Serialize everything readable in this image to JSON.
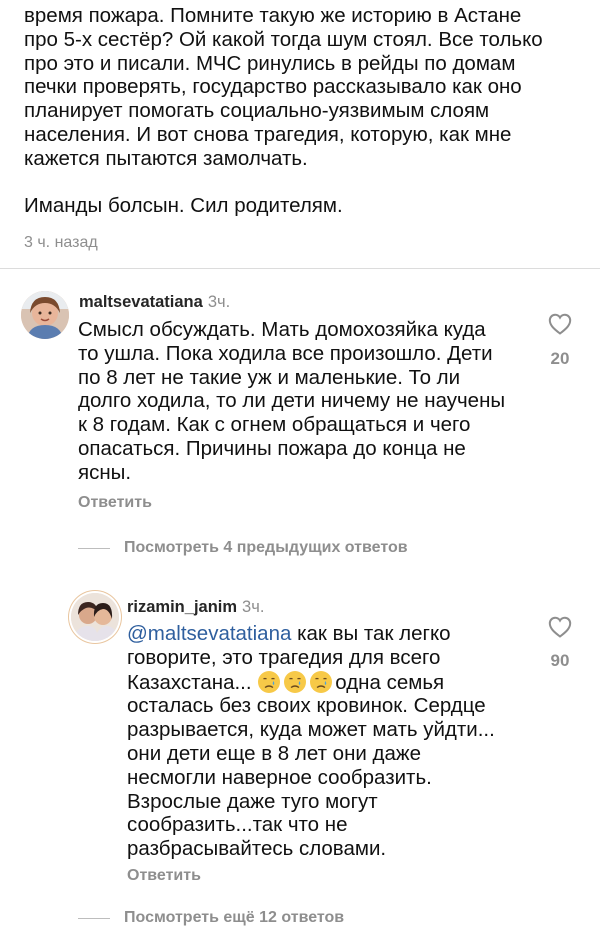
{
  "post_tail": {
    "lines": [
      "время пожара. Помните такую же историю в Астане",
      "про 5-х сестёр? Ой какой тогда шум стоял. Все только",
      "про это и писали. МЧС ринулись в рейды по домам",
      "печки проверять, государство рассказывало как оно",
      "планирует помогать социально-уязвимым слоям",
      "населения. И вот снова трагедия, которую, как мне",
      "кажется пытаются замолчать."
    ],
    "closing": "Иманды болсын. Сил родителям.",
    "time": "3 ч. назад"
  },
  "comments": [
    {
      "username": "maltsevatatiana",
      "time": "3ч.",
      "lines": [
        "Смысл обсуждать. Мать домохозяйка куда",
        "то ушла. Пока ходила все произошло. Дети",
        "по 8 лет не такие уж и маленькие. То ли",
        "долго ходила, то ли дети ничему не научены",
        "к 8 годам. Как с огнем обращаться и чего",
        "опасаться. Причины пожара до конца не",
        "ясны."
      ],
      "reply_label": "Ответить",
      "likes": "20",
      "view_more": "Посмотреть 4 предыдущих ответов"
    },
    {
      "username": "rizamin_janim",
      "time": "3ч.",
      "mention": "@maltsevatatiana",
      "first_line_rest": " как вы так легко",
      "lines_a": [
        "говорите, это трагедия для всего",
        "Казахстана..."
      ],
      "after_emoji": "одна семья",
      "lines_b": [
        "осталась без своих кровинок. Сердце",
        "разрывается, куда может мать уйдти...",
        "они дети еще в 8 лет они даже",
        "несмогли наверное сообразить.",
        "Взрослые даже туго могут",
        "сообразить...так что не",
        "разбрасывайтесь словами."
      ],
      "emojis": [
        "crying-face-icon",
        "crying-face-icon",
        "crying-face-icon"
      ],
      "reply_label": "Ответить",
      "likes": "90",
      "view_more": "Посмотреть ещё 12 ответов"
    }
  ],
  "colors": {
    "text": "#111111",
    "muted": "#8e8e8e",
    "mention": "#2f5f9e",
    "divider": "#dcdcdc"
  }
}
